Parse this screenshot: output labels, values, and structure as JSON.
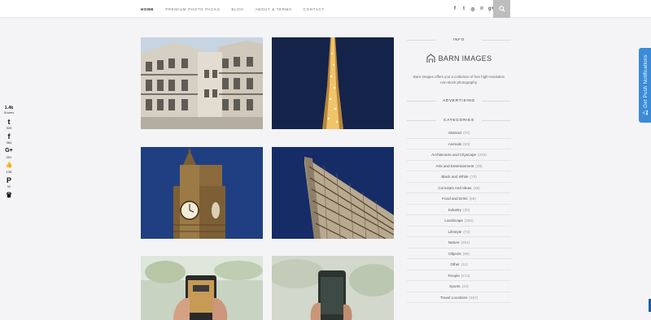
{
  "nav": {
    "items": [
      "Home",
      "Premium Photo Packs",
      "Blog",
      "About & Terms",
      "Contact"
    ],
    "active_index": 0
  },
  "social_top": {
    "icons": [
      "facebook-icon",
      "twitter-icon",
      "instagram-icon",
      "pinterest-icon",
      "google-plus-icon"
    ],
    "glyphs": [
      "f",
      "t",
      "◎",
      "℗",
      "g+"
    ]
  },
  "search": {
    "icon": "search-icon"
  },
  "sharebar": {
    "total": "1.4k",
    "total_label": "Shares",
    "items": [
      {
        "name": "twitter",
        "glyph": "t",
        "count": "925"
      },
      {
        "name": "facebook",
        "glyph": "f",
        "count": "384"
      },
      {
        "name": "google-plus",
        "glyph": "G+",
        "count": "251"
      },
      {
        "name": "like",
        "glyph": "👍",
        "count": "135"
      },
      {
        "name": "pinterest",
        "glyph": "P",
        "count": "92"
      },
      {
        "name": "crown",
        "glyph": "♛",
        "count": ""
      }
    ]
  },
  "photos": [
    {
      "subject": "Paris building facade"
    },
    {
      "subject": "Eiffel Tower at night"
    },
    {
      "subject": "Big Ben clock tower"
    },
    {
      "subject": "Flatiron building"
    },
    {
      "subject": "Phone in hand"
    },
    {
      "subject": "Phone in hand"
    }
  ],
  "sidebar": {
    "info_heading": "Info",
    "brand_name": "BARN IMAGES",
    "about": "Barn Images offers you a collection of free high-resolution non-stock photography.",
    "advertising_heading": "Advertising",
    "categories_heading": "Categories",
    "categories": [
      {
        "name": "Abstract",
        "count": "(70)"
      },
      {
        "name": "Animals",
        "count": "(63)"
      },
      {
        "name": "Architecture and Cityscape",
        "count": "(225)"
      },
      {
        "name": "Arts and Entertainment",
        "count": "(39)"
      },
      {
        "name": "Black and White",
        "count": "(70)"
      },
      {
        "name": "Concepts And Ideas",
        "count": "(38)"
      },
      {
        "name": "Food and Drink",
        "count": "(59)"
      },
      {
        "name": "Industry",
        "count": "(40)"
      },
      {
        "name": "Landscape",
        "count": "(282)"
      },
      {
        "name": "Lifestyle",
        "count": "(73)"
      },
      {
        "name": "Nature",
        "count": "(361)"
      },
      {
        "name": "Objects",
        "count": "(99)"
      },
      {
        "name": "Other",
        "count": "(11)"
      },
      {
        "name": "People",
        "count": "(213)"
      },
      {
        "name": "Sports",
        "count": "(24)"
      },
      {
        "name": "Travel Locations",
        "count": "(267)"
      }
    ]
  },
  "push": {
    "label": "Get Push Notifications",
    "icon": "bell-icon"
  },
  "colors": {
    "accent": "#3a8bd8",
    "page_bg": "#f4f4f6",
    "search_bg": "#bdbdbd"
  }
}
